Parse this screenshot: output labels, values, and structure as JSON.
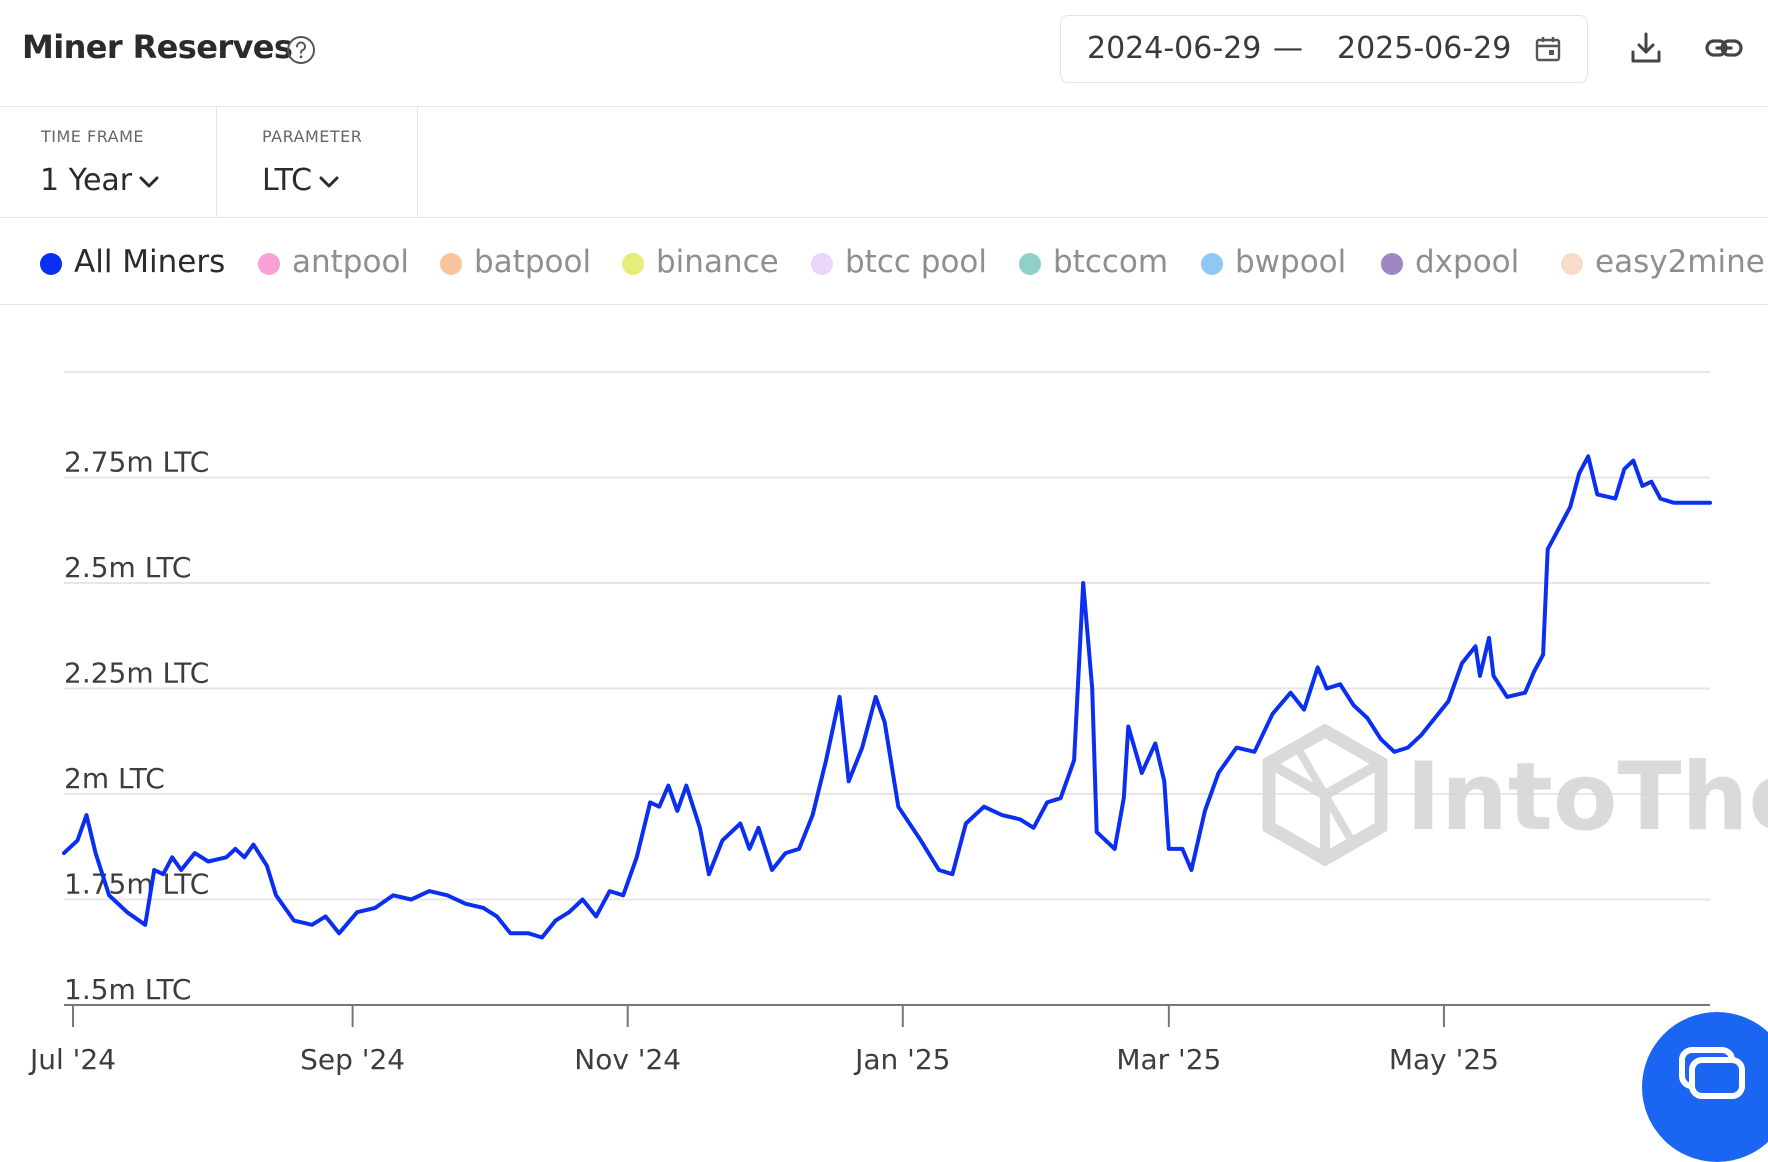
{
  "header": {
    "title": "Miner Reserves",
    "help_icon": "question-circle-icon",
    "date_start": "2024-06-29",
    "date_separator": "—",
    "date_end": "2025-06-29",
    "calendar_icon": "calendar-icon",
    "download_icon": "download-icon",
    "link_icon": "link-icon"
  },
  "filters": {
    "time_frame": {
      "label": "TIME FRAME",
      "value": "1 Year"
    },
    "parameter": {
      "label": "PARAMETER",
      "value": "LTC"
    }
  },
  "legend": [
    {
      "name": "All Miners",
      "color": "#0a2ff0",
      "active": true
    },
    {
      "name": "antpool",
      "color": "#f7a1d4",
      "active": false
    },
    {
      "name": "batpool",
      "color": "#f9c39c",
      "active": false
    },
    {
      "name": "binance",
      "color": "#e6ed7a",
      "active": false
    },
    {
      "name": "btcc pool",
      "color": "#ecd5fb",
      "active": false
    },
    {
      "name": "btccom",
      "color": "#8fd1c8",
      "active": false
    },
    {
      "name": "bwpool",
      "color": "#8ec8f6",
      "active": false
    },
    {
      "name": "dxpool",
      "color": "#9f86c4",
      "active": false
    },
    {
      "name": "easy2mine",
      "color": "#f8dcc8",
      "active": false
    }
  ],
  "watermark": "IntoTheBlock",
  "chart_data": {
    "type": "line",
    "title": "",
    "xlabel": "",
    "ylabel": "",
    "line_color": "#0a2ff0",
    "grid": true,
    "x_range": [
      "2024-06-29",
      "2025-06-29"
    ],
    "ylim": [
      1.5,
      3.0
    ],
    "y_ticks": [
      {
        "value": 1.5,
        "label": "1.5m LTC"
      },
      {
        "value": 1.75,
        "label": "1.75m LTC"
      },
      {
        "value": 2.0,
        "label": "2m LTC"
      },
      {
        "value": 2.25,
        "label": "2.25m LTC"
      },
      {
        "value": 2.5,
        "label": "2.5m LTC"
      },
      {
        "value": 2.75,
        "label": "2.75m LTC"
      },
      {
        "value": 3.0,
        "label": ""
      }
    ],
    "x_ticks": [
      {
        "date": "2024-07-01",
        "label": "Jul '24"
      },
      {
        "date": "2024-09-01",
        "label": "Sep '24"
      },
      {
        "date": "2024-11-01",
        "label": "Nov '24"
      },
      {
        "date": "2025-01-01",
        "label": "Jan '25"
      },
      {
        "date": "2025-03-01",
        "label": "Mar '25"
      },
      {
        "date": "2025-05-01",
        "label": "May '25"
      }
    ],
    "series": [
      {
        "name": "All Miners",
        "unit": "million LTC",
        "points": [
          [
            "2024-06-29",
            1.86
          ],
          [
            "2024-07-02",
            1.89
          ],
          [
            "2024-07-04",
            1.95
          ],
          [
            "2024-07-06",
            1.86
          ],
          [
            "2024-07-09",
            1.76
          ],
          [
            "2024-07-13",
            1.72
          ],
          [
            "2024-07-17",
            1.69
          ],
          [
            "2024-07-19",
            1.82
          ],
          [
            "2024-07-21",
            1.81
          ],
          [
            "2024-07-23",
            1.85
          ],
          [
            "2024-07-25",
            1.82
          ],
          [
            "2024-07-28",
            1.86
          ],
          [
            "2024-07-31",
            1.84
          ],
          [
            "2024-08-04",
            1.85
          ],
          [
            "2024-08-06",
            1.87
          ],
          [
            "2024-08-08",
            1.85
          ],
          [
            "2024-08-10",
            1.88
          ],
          [
            "2024-08-13",
            1.83
          ],
          [
            "2024-08-15",
            1.76
          ],
          [
            "2024-08-19",
            1.7
          ],
          [
            "2024-08-23",
            1.69
          ],
          [
            "2024-08-26",
            1.71
          ],
          [
            "2024-08-29",
            1.67
          ],
          [
            "2024-09-02",
            1.72
          ],
          [
            "2024-09-06",
            1.73
          ],
          [
            "2024-09-10",
            1.76
          ],
          [
            "2024-09-14",
            1.75
          ],
          [
            "2024-09-18",
            1.77
          ],
          [
            "2024-09-22",
            1.76
          ],
          [
            "2024-09-26",
            1.74
          ],
          [
            "2024-09-30",
            1.73
          ],
          [
            "2024-10-03",
            1.71
          ],
          [
            "2024-10-06",
            1.67
          ],
          [
            "2024-10-10",
            1.67
          ],
          [
            "2024-10-13",
            1.66
          ],
          [
            "2024-10-16",
            1.7
          ],
          [
            "2024-10-19",
            1.72
          ],
          [
            "2024-10-22",
            1.75
          ],
          [
            "2024-10-25",
            1.71
          ],
          [
            "2024-10-28",
            1.77
          ],
          [
            "2024-10-31",
            1.76
          ],
          [
            "2024-11-03",
            1.85
          ],
          [
            "2024-11-06",
            1.98
          ],
          [
            "2024-11-08",
            1.97
          ],
          [
            "2024-11-10",
            2.02
          ],
          [
            "2024-11-12",
            1.96
          ],
          [
            "2024-11-14",
            2.02
          ],
          [
            "2024-11-17",
            1.92
          ],
          [
            "2024-11-19",
            1.81
          ],
          [
            "2024-11-22",
            1.89
          ],
          [
            "2024-11-26",
            1.93
          ],
          [
            "2024-11-28",
            1.87
          ],
          [
            "2024-11-30",
            1.92
          ],
          [
            "2024-12-03",
            1.82
          ],
          [
            "2024-12-06",
            1.86
          ],
          [
            "2024-12-09",
            1.87
          ],
          [
            "2024-12-12",
            1.95
          ],
          [
            "2024-12-15",
            2.08
          ],
          [
            "2024-12-18",
            2.23
          ],
          [
            "2024-12-20",
            2.03
          ],
          [
            "2024-12-23",
            2.11
          ],
          [
            "2024-12-26",
            2.23
          ],
          [
            "2024-12-28",
            2.17
          ],
          [
            "2024-12-31",
            1.97
          ],
          [
            "2025-01-05",
            1.89
          ],
          [
            "2025-01-09",
            1.82
          ],
          [
            "2025-01-12",
            1.81
          ],
          [
            "2025-01-15",
            1.93
          ],
          [
            "2025-01-19",
            1.97
          ],
          [
            "2025-01-23",
            1.95
          ],
          [
            "2025-01-27",
            1.94
          ],
          [
            "2025-01-30",
            1.92
          ],
          [
            "2025-02-02",
            1.98
          ],
          [
            "2025-02-05",
            1.99
          ],
          [
            "2025-02-08",
            2.08
          ],
          [
            "2025-02-10",
            2.5
          ],
          [
            "2025-02-12",
            2.25
          ],
          [
            "2025-02-13",
            1.91
          ],
          [
            "2025-02-17",
            1.87
          ],
          [
            "2025-02-19",
            1.99
          ],
          [
            "2025-02-20",
            2.16
          ],
          [
            "2025-02-23",
            2.05
          ],
          [
            "2025-02-26",
            2.12
          ],
          [
            "2025-02-28",
            2.03
          ],
          [
            "2025-03-01",
            1.87
          ],
          [
            "2025-03-04",
            1.87
          ],
          [
            "2025-03-06",
            1.82
          ],
          [
            "2025-03-09",
            1.96
          ],
          [
            "2025-03-12",
            2.05
          ],
          [
            "2025-03-16",
            2.11
          ],
          [
            "2025-03-20",
            2.1
          ],
          [
            "2025-03-24",
            2.19
          ],
          [
            "2025-03-28",
            2.24
          ],
          [
            "2025-03-31",
            2.2
          ],
          [
            "2025-04-03",
            2.3
          ],
          [
            "2025-04-05",
            2.25
          ],
          [
            "2025-04-08",
            2.26
          ],
          [
            "2025-04-11",
            2.21
          ],
          [
            "2025-04-14",
            2.18
          ],
          [
            "2025-04-17",
            2.13
          ],
          [
            "2025-04-20",
            2.1
          ],
          [
            "2025-04-23",
            2.11
          ],
          [
            "2025-04-26",
            2.14
          ],
          [
            "2025-04-29",
            2.18
          ],
          [
            "2025-05-02",
            2.22
          ],
          [
            "2025-05-05",
            2.31
          ],
          [
            "2025-05-08",
            2.35
          ],
          [
            "2025-05-09",
            2.28
          ],
          [
            "2025-05-11",
            2.37
          ],
          [
            "2025-05-12",
            2.28
          ],
          [
            "2025-05-15",
            2.23
          ],
          [
            "2025-05-19",
            2.24
          ],
          [
            "2025-05-21",
            2.29
          ],
          [
            "2025-05-23",
            2.33
          ],
          [
            "2025-05-24",
            2.58
          ],
          [
            "2025-05-26",
            2.62
          ],
          [
            "2025-05-29",
            2.68
          ],
          [
            "2025-05-31",
            2.76
          ],
          [
            "2025-06-02",
            2.8
          ],
          [
            "2025-06-04",
            2.71
          ],
          [
            "2025-06-08",
            2.7
          ],
          [
            "2025-06-10",
            2.77
          ],
          [
            "2025-06-12",
            2.79
          ],
          [
            "2025-06-14",
            2.73
          ],
          [
            "2025-06-16",
            2.74
          ],
          [
            "2025-06-18",
            2.7
          ],
          [
            "2025-06-21",
            2.69
          ],
          [
            "2025-06-24",
            2.69
          ],
          [
            "2025-06-29",
            2.69
          ]
        ]
      }
    ]
  },
  "chat_widget": {
    "icon": "chat-icon"
  }
}
